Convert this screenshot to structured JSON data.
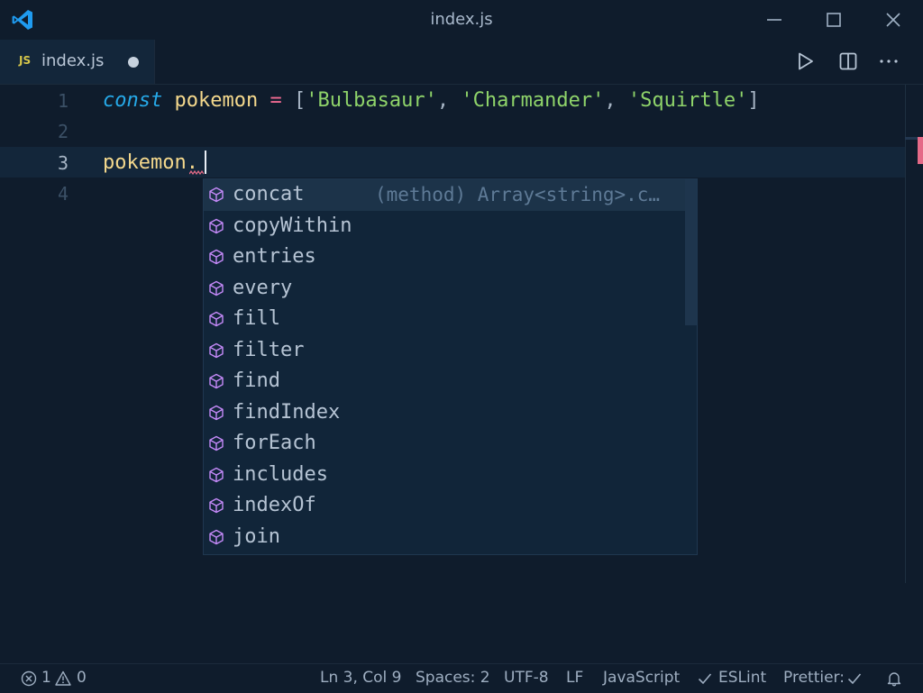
{
  "window": {
    "title": "index.js",
    "icons": [
      "vscode-logo",
      "minimize-icon",
      "maximize-icon",
      "close-icon"
    ]
  },
  "tab": {
    "language_badge": "JS",
    "label": "index.js",
    "dirty": true,
    "actions": [
      "run-icon",
      "split-editor-icon",
      "more-actions-icon"
    ]
  },
  "editor": {
    "line_numbers": [
      "1",
      "2",
      "3",
      "4"
    ],
    "active_line": 3,
    "line1": {
      "keyword": "const",
      "identifier": "pokemon",
      "operator": "=",
      "open_bracket": "[",
      "string1": "'Bulbasaur'",
      "comma1": ",",
      "string2": "'Charmander'",
      "comma2": ",",
      "string3": "'Squirtle'",
      "close_bracket": "]"
    },
    "line3": "pokemon."
  },
  "suggest": {
    "icon": "method-cube-icon",
    "items": [
      {
        "label": "concat",
        "detail": "(method) Array<string>.c…"
      },
      {
        "label": "copyWithin",
        "detail": ""
      },
      {
        "label": "entries",
        "detail": ""
      },
      {
        "label": "every",
        "detail": ""
      },
      {
        "label": "fill",
        "detail": ""
      },
      {
        "label": "filter",
        "detail": ""
      },
      {
        "label": "find",
        "detail": ""
      },
      {
        "label": "findIndex",
        "detail": ""
      },
      {
        "label": "forEach",
        "detail": ""
      },
      {
        "label": "includes",
        "detail": ""
      },
      {
        "label": "indexOf",
        "detail": ""
      },
      {
        "label": "join",
        "detail": ""
      }
    ]
  },
  "statusbar": {
    "errors": "1",
    "warnings": "0",
    "position": "Ln 3, Col 9",
    "spaces": "Spaces: 2",
    "encoding": "UTF-8",
    "eol": "LF",
    "language": "JavaScript",
    "eslint": "ESLint",
    "prettier": "Prettier:"
  },
  "colors": {
    "background": "#0f1c2c",
    "keyword": "#26a9e8",
    "variable": "#f5d98d",
    "operator": "#f06a92",
    "string": "#8fd46a",
    "method_icon": "#c58af9",
    "error": "#e56a87"
  }
}
